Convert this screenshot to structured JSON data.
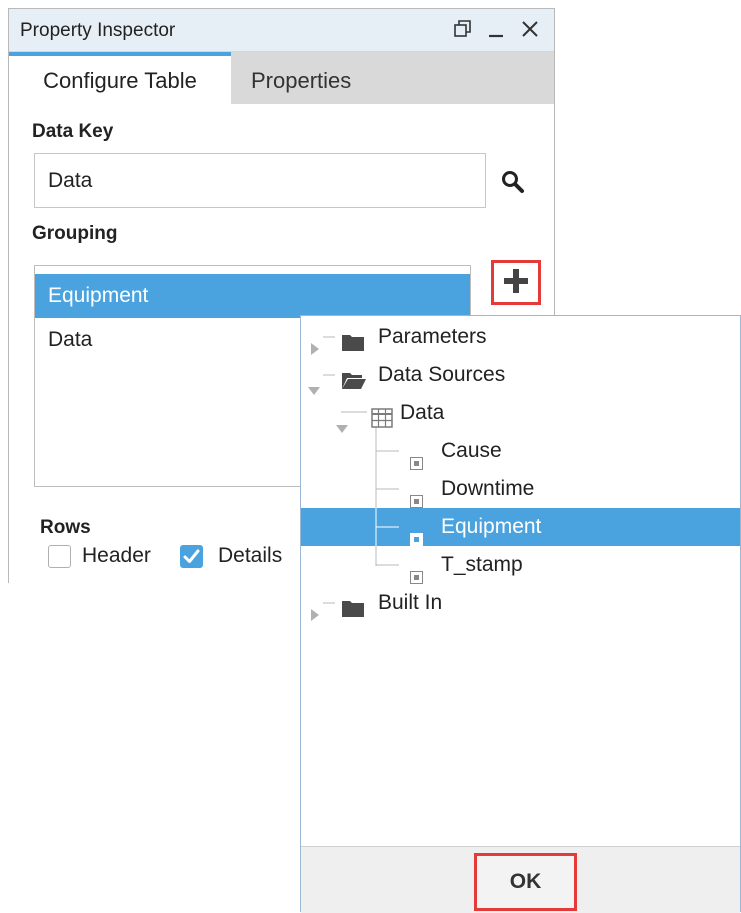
{
  "inspector": {
    "title": "Property Inspector",
    "tabs": [
      {
        "label": "Configure Table",
        "active": true
      },
      {
        "label": "Properties",
        "active": false
      }
    ],
    "data_key": {
      "label": "Data Key",
      "value": "Data",
      "icon": "search-icon"
    },
    "grouping": {
      "label": "Grouping",
      "items": [
        {
          "label": "Equipment",
          "selected": true
        },
        {
          "label": "Data",
          "selected": false
        }
      ],
      "add_icon": "plus-icon"
    },
    "rows": {
      "label": "Rows",
      "options": [
        {
          "label": "Header",
          "checked": false
        },
        {
          "label": "Details",
          "checked": true
        }
      ]
    },
    "window_controls": [
      "restore-icon",
      "minimize-icon",
      "close-icon"
    ]
  },
  "popup": {
    "tree": [
      {
        "label": "Parameters",
        "icon": "folder-closed-icon",
        "expanded": false
      },
      {
        "label": "Data Sources",
        "icon": "folder-open-icon",
        "expanded": true
      },
      {
        "label": "Data",
        "icon": "table-icon",
        "expanded": true
      },
      {
        "label": "Cause",
        "icon": "column-icon"
      },
      {
        "label": "Downtime",
        "icon": "column-icon"
      },
      {
        "label": "Equipment",
        "icon": "column-icon",
        "selected": true
      },
      {
        "label": "T_stamp",
        "icon": "column-icon"
      },
      {
        "label": "Built In",
        "icon": "folder-closed-icon",
        "expanded": false
      }
    ],
    "ok_label": "OK"
  },
  "colors": {
    "accent": "#4aa3df",
    "highlight_border": "#e53a3a",
    "titlebar": "#e6eef6",
    "folder": "#4a4a4a"
  }
}
